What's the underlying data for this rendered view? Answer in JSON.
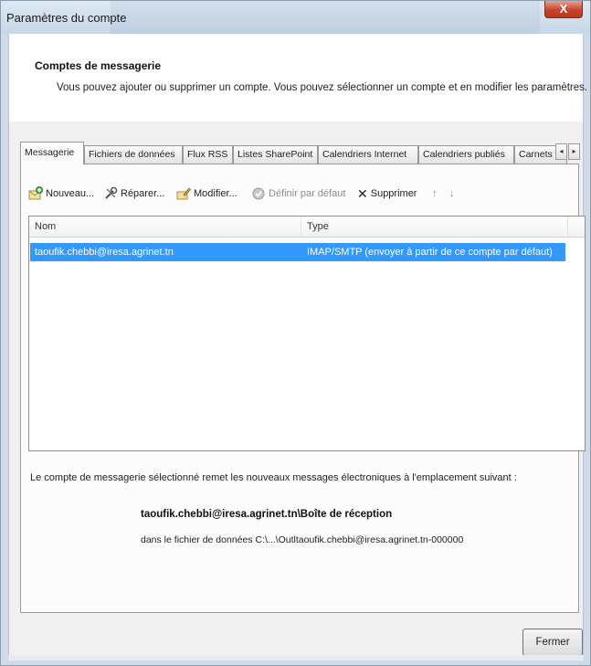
{
  "window": {
    "title": "Paramètres du compte",
    "close_label": "X"
  },
  "header": {
    "title": "Comptes de messagerie",
    "description": "Vous pouvez ajouter ou supprimer un compte. Vous pouvez sélectionner un compte et en modifier les paramètres."
  },
  "tabs": [
    {
      "label": "Messagerie",
      "active": true
    },
    {
      "label": "Fichiers de données",
      "active": false
    },
    {
      "label": "Flux RSS",
      "active": false
    },
    {
      "label": "Listes SharePoint",
      "active": false
    },
    {
      "label": "Calendriers Internet",
      "active": false
    },
    {
      "label": "Calendriers publiés",
      "active": false
    },
    {
      "label": "Carnets d",
      "active": false
    }
  ],
  "tab_scroll": {
    "left": "◂",
    "right": "▸"
  },
  "toolbar": {
    "new_label": "Nouveau...",
    "repair_label": "Réparer...",
    "modify_label": "Modifier...",
    "default_label": "Définir par défaut",
    "delete_label": "Supprimer",
    "up_glyph": "↑",
    "down_glyph": "↓",
    "delete_glyph": "✕"
  },
  "accounts_list": {
    "columns": [
      "Nom",
      "Type"
    ],
    "rows": [
      {
        "name": "taoufik.chebbi@iresa.agrinet.tn",
        "type": "IMAP/SMTP (envoyer à partir de ce compte par défaut)",
        "selected": true
      }
    ]
  },
  "info": {
    "text": "Le compte de messagerie sélectionné remet les nouveaux messages électroniques à l'emplacement suivant :",
    "path": "taoufik.chebbi@iresa.agrinet.tn\\Boîte de réception",
    "file": "dans le fichier de données C:\\...\\Outltaoufik.chebbi@iresa.agrinet.tn-000000"
  },
  "buttons": {
    "close_label": "Fermer"
  },
  "colors": {
    "selection": "#3399ff",
    "close_button": "#c4462d"
  }
}
